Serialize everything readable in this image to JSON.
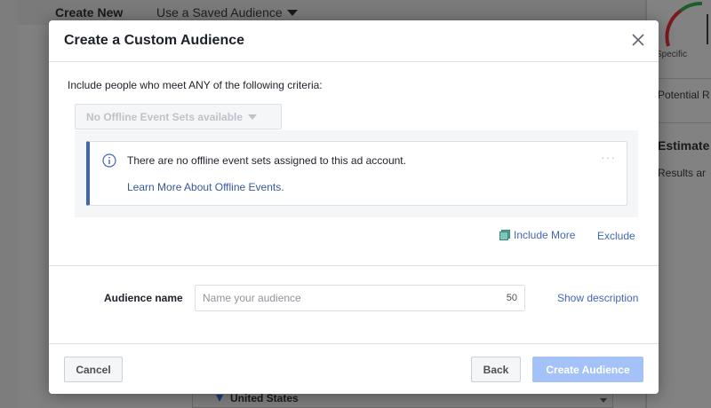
{
  "background": {
    "tabs": {
      "create_new": "Create New",
      "saved_audience": "Use a Saved Audience"
    },
    "side_panel": {
      "gauge_label": "Specific",
      "potential_reach": "Potential R",
      "estimate_title": "Estimate",
      "results_text": "Results ar"
    },
    "location_value": "United States"
  },
  "modal": {
    "title": "Create a Custom Audience",
    "criteria_text": "Include people who meet ANY of the following criteria:",
    "offline_select": {
      "label": "No Offline Event Sets available",
      "disabled": true
    },
    "notice": {
      "message": "There are no offline event sets assigned to this ad account.",
      "link": "Learn More About Offline Events.",
      "more_icon": "ellipsis-icon",
      "info_icon": "info-icon"
    },
    "include_more": "Include More",
    "exclude": "Exclude",
    "audience_name": {
      "label": "Audience name",
      "placeholder": "Name your audience",
      "value": "",
      "remaining_chars": "50"
    },
    "show_description": "Show description",
    "footer": {
      "cancel": "Cancel",
      "back": "Back",
      "create": "Create Audience"
    }
  },
  "colors": {
    "accent_blue": "#4267b2",
    "link_blue": "#365899",
    "disabled_primary": "#a4c2f7",
    "notice_border": "#4267b2",
    "gauge_red": "#c2262d",
    "gauge_green": "#2e8b3d"
  }
}
